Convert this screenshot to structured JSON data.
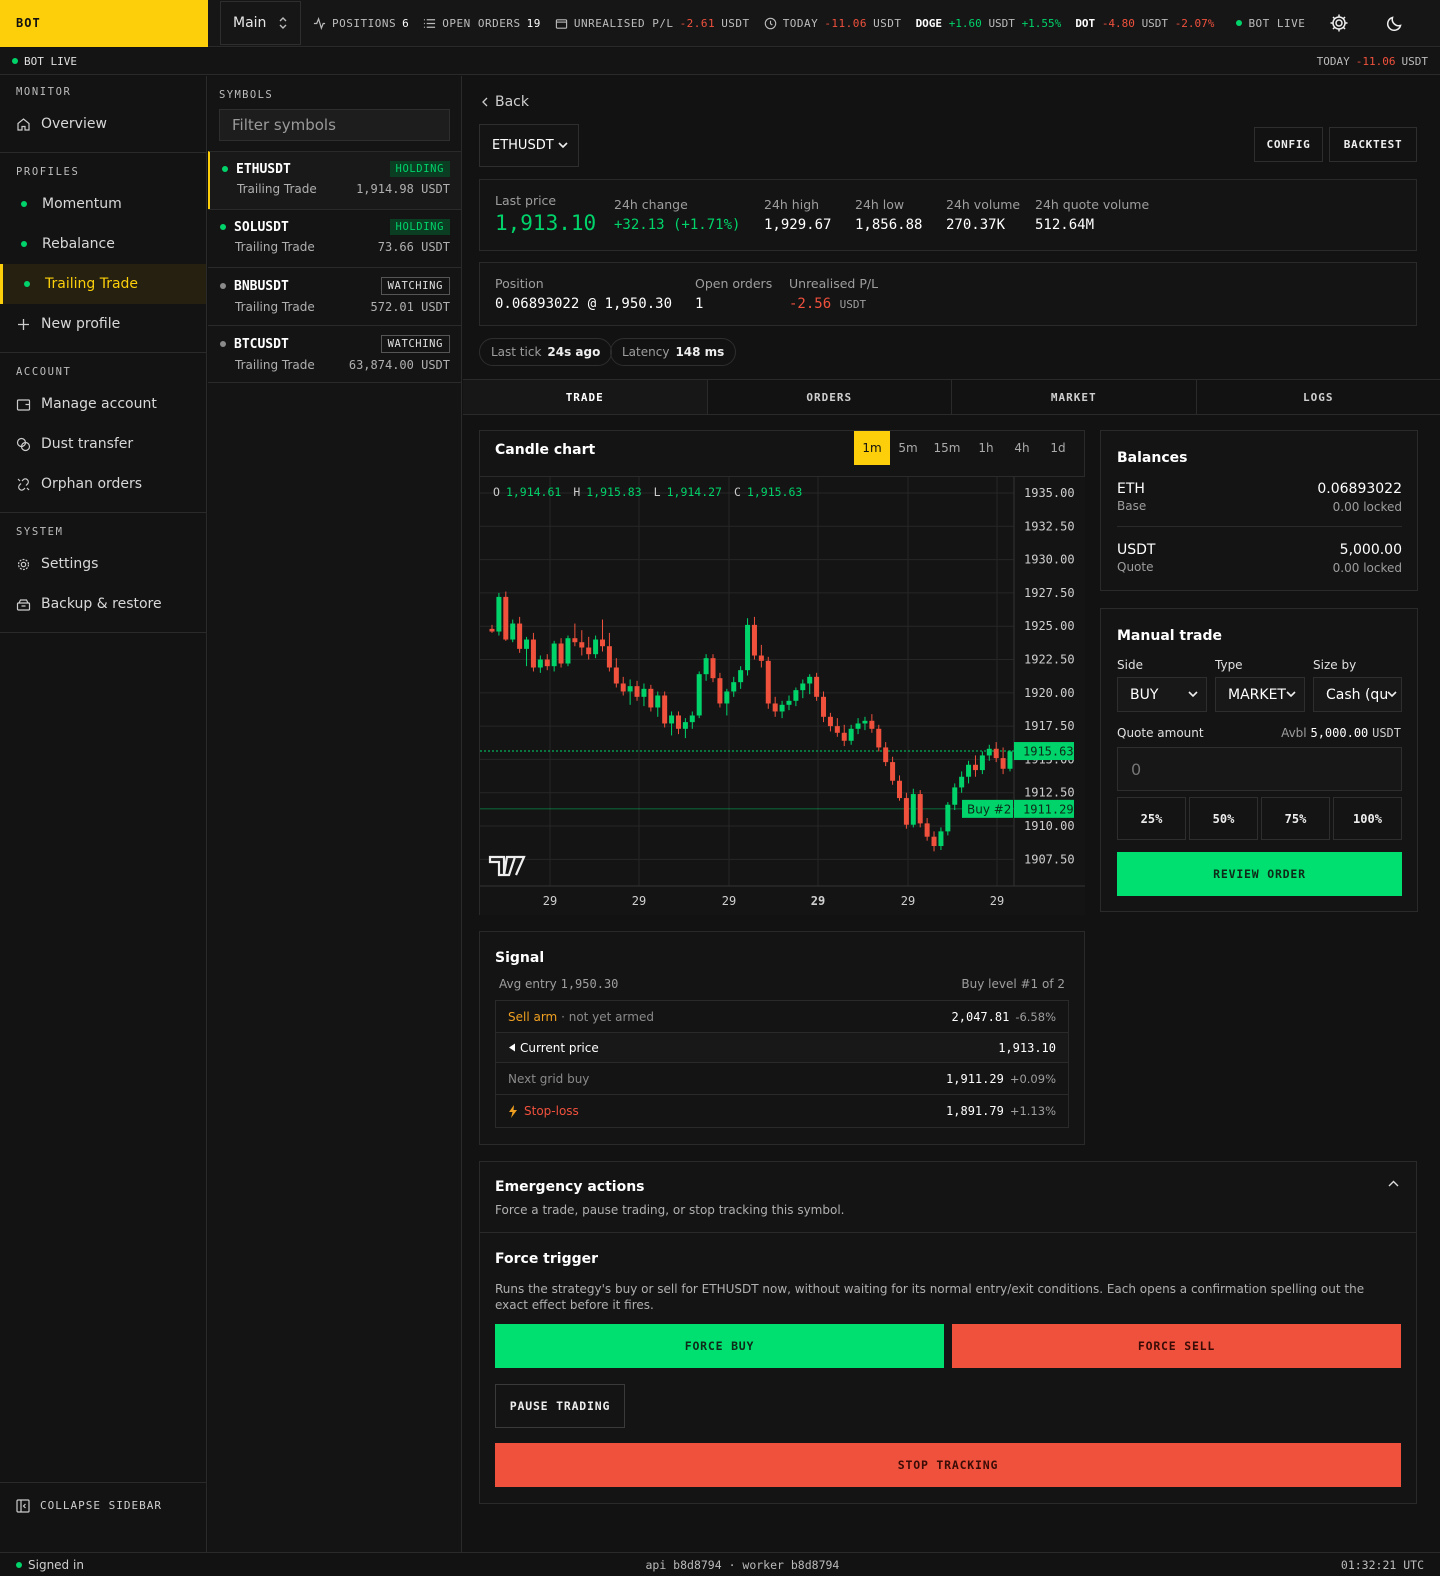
{
  "topbar": {
    "logo": "BOT",
    "profile": "Main",
    "positions_label": "POSITIONS",
    "positions_value": "6",
    "open_orders_label": "OPEN ORDERS",
    "open_orders_value": "19",
    "unrealised_label": "UNREALISED P/L",
    "unrealised_value": "-2.61",
    "unrealised_unit": "USDT",
    "today_label": "TODAY",
    "today_value": "-11.06",
    "today_unit": "USDT",
    "tickers": [
      {
        "symbol": "DOGE",
        "change": "+1.60",
        "unit": "USDT",
        "pct": "+1.55%",
        "color": "#00d36a"
      },
      {
        "symbol": "DOT",
        "change": "-4.80",
        "unit": "USDT",
        "pct": "-2.07%",
        "color": "#f0513d"
      }
    ],
    "bot_live": "BOT LIVE"
  },
  "statusbar": {
    "bot_live": "BOT LIVE",
    "today_label": "TODAY",
    "today_value": "-11.06",
    "today_unit": "USDT"
  },
  "sidebar": {
    "monitor_head": "MONITOR",
    "overview": "Overview",
    "profiles_head": "PROFILES",
    "profiles": [
      "Momentum",
      "Rebalance",
      "Trailing Trade"
    ],
    "new_profile": "New profile",
    "account_head": "ACCOUNT",
    "manage_account": "Manage account",
    "dust_transfer": "Dust transfer",
    "orphan_orders": "Orphan orders",
    "system_head": "SYSTEM",
    "settings": "Settings",
    "backup": "Backup & restore",
    "collapse": "COLLAPSE SIDEBAR"
  },
  "symbols": {
    "head": "SYMBOLS",
    "filter_placeholder": "Filter symbols",
    "items": [
      {
        "name": "ETHUSDT",
        "status": "HOLDING",
        "profile": "Trailing Trade",
        "price": "1,914.98 USDT"
      },
      {
        "name": "SOLUSDT",
        "status": "HOLDING",
        "profile": "Trailing Trade",
        "price": "73.66 USDT"
      },
      {
        "name": "BNBUSDT",
        "status": "WATCHING",
        "profile": "Trailing Trade",
        "price": "572.01 USDT"
      },
      {
        "name": "BTCUSDT",
        "status": "WATCHING",
        "profile": "Trailing Trade",
        "price": "63,874.00 USDT"
      }
    ]
  },
  "main": {
    "back": "Back",
    "symbol": "ETHUSDT",
    "config": "CONFIG",
    "backtest": "BACKTEST",
    "last_price_label": "Last price",
    "last_price": "1,913.10",
    "change_label": "24h change",
    "change": "+32.13 (+1.71%)",
    "high_label": "24h high",
    "high": "1,929.67",
    "low_label": "24h low",
    "low": "1,856.88",
    "volume_label": "24h volume",
    "volume": "270.37K",
    "quote_volume_label": "24h quote volume",
    "quote_volume": "512.64M",
    "position_label": "Position",
    "position": "0.06893022 @ 1,950.30",
    "open_orders_label": "Open orders",
    "open_orders": "1",
    "upl_label": "Unrealised P/L",
    "upl": "-2.56",
    "upl_unit": "USDT",
    "last_tick_label": "Last tick",
    "last_tick": "24s ago",
    "latency_label": "Latency",
    "latency": "148 ms",
    "tabs": [
      "TRADE",
      "ORDERS",
      "MARKET",
      "LOGS"
    ]
  },
  "chart": {
    "title": "Candle chart",
    "timeframes": [
      "1m",
      "5m",
      "15m",
      "1h",
      "4h",
      "1d"
    ],
    "ohlc": {
      "o_label": "O",
      "o": "1,914.61",
      "h_label": "H",
      "h": "1,915.83",
      "l_label": "L",
      "l": "1,914.27",
      "c_label": "C",
      "c": "1,915.63"
    }
  },
  "chart_data": {
    "type": "candlestick",
    "y_ticks": [
      "1935.00",
      "1932.50",
      "1930.00",
      "1927.50",
      "1925.00",
      "1922.50",
      "1920.00",
      "1917.50",
      "1915.00",
      "1912.50",
      "1910.00",
      "1907.50"
    ],
    "x_ticks": [
      "29",
      "29",
      "29",
      "29",
      "29",
      "29"
    ],
    "ylim": [
      1905.5,
      1936.2
    ],
    "up_color": "#00d36a",
    "down_color": "#f0513d",
    "price_tag": "1915.63",
    "buy_tag_label": "Buy #2",
    "buy_tag": "1911.29",
    "price_line": 1915.63,
    "buy_line": 1911.29,
    "candles": [
      [
        1924.8,
        1925.1,
        1924.5,
        1924.6
      ],
      [
        1924.6,
        1927.5,
        1924.3,
        1927.2
      ],
      [
        1927.2,
        1927.6,
        1923.9,
        1924.0
      ],
      [
        1924.0,
        1925.5,
        1923.8,
        1925.2
      ],
      [
        1925.2,
        1925.7,
        1923.0,
        1923.3
      ],
      [
        1923.3,
        1924.2,
        1922.0,
        1924.0
      ],
      [
        1924.0,
        1924.5,
        1921.6,
        1921.9
      ],
      [
        1921.9,
        1922.8,
        1921.5,
        1922.5
      ],
      [
        1922.5,
        1922.9,
        1921.7,
        1922.0
      ],
      [
        1922.0,
        1923.9,
        1921.6,
        1923.7
      ],
      [
        1923.7,
        1924.1,
        1921.9,
        1922.2
      ],
      [
        1922.2,
        1924.3,
        1922.0,
        1924.1
      ],
      [
        1924.1,
        1925.2,
        1923.5,
        1923.8
      ],
      [
        1923.8,
        1924.7,
        1922.8,
        1923.4
      ],
      [
        1923.4,
        1924.2,
        1922.5,
        1922.9
      ],
      [
        1922.9,
        1924.3,
        1922.6,
        1924.0
      ],
      [
        1924.0,
        1925.5,
        1923.1,
        1923.5
      ],
      [
        1923.5,
        1924.5,
        1921.6,
        1921.9
      ],
      [
        1921.9,
        1922.6,
        1920.4,
        1920.7
      ],
      [
        1920.7,
        1921.2,
        1919.8,
        1920.1
      ],
      [
        1920.1,
        1921.0,
        1919.1,
        1920.5
      ],
      [
        1920.5,
        1920.9,
        1919.4,
        1919.7
      ],
      [
        1919.7,
        1920.7,
        1919.0,
        1920.3
      ],
      [
        1920.3,
        1920.6,
        1918.6,
        1918.9
      ],
      [
        1918.9,
        1920.1,
        1918.2,
        1919.8
      ],
      [
        1919.8,
        1920.1,
        1917.4,
        1917.7
      ],
      [
        1917.7,
        1918.6,
        1916.8,
        1918.3
      ],
      [
        1918.3,
        1918.6,
        1916.9,
        1917.3
      ],
      [
        1917.3,
        1918.1,
        1916.6,
        1917.8
      ],
      [
        1917.8,
        1918.6,
        1917.3,
        1918.3
      ],
      [
        1918.3,
        1921.6,
        1918.1,
        1921.4
      ],
      [
        1921.4,
        1922.9,
        1920.9,
        1922.6
      ],
      [
        1922.6,
        1922.9,
        1920.8,
        1921.1
      ],
      [
        1921.1,
        1921.5,
        1918.9,
        1919.2
      ],
      [
        1919.2,
        1920.3,
        1918.3,
        1920.1
      ],
      [
        1920.1,
        1921.2,
        1919.7,
        1920.8
      ],
      [
        1920.8,
        1922.0,
        1920.3,
        1921.7
      ],
      [
        1921.7,
        1925.6,
        1921.3,
        1925.1
      ],
      [
        1925.1,
        1925.7,
        1922.5,
        1922.8
      ],
      [
        1922.8,
        1923.6,
        1921.9,
        1922.4
      ],
      [
        1922.4,
        1922.7,
        1918.8,
        1919.2
      ],
      [
        1919.2,
        1919.7,
        1918.2,
        1918.6
      ],
      [
        1918.6,
        1919.4,
        1918.1,
        1919.1
      ],
      [
        1919.1,
        1919.8,
        1918.7,
        1919.4
      ],
      [
        1919.4,
        1920.4,
        1919.0,
        1920.2
      ],
      [
        1920.2,
        1921.0,
        1919.6,
        1920.7
      ],
      [
        1920.7,
        1921.4,
        1919.9,
        1921.2
      ],
      [
        1921.2,
        1921.5,
        1919.4,
        1919.7
      ],
      [
        1919.7,
        1920.1,
        1917.8,
        1918.2
      ],
      [
        1918.2,
        1918.5,
        1917.1,
        1917.5
      ],
      [
        1917.5,
        1918.1,
        1916.7,
        1917.0
      ],
      [
        1917.0,
        1917.6,
        1916.0,
        1916.4
      ],
      [
        1916.4,
        1917.6,
        1916.1,
        1917.3
      ],
      [
        1917.3,
        1918.1,
        1916.9,
        1917.7
      ],
      [
        1917.7,
        1918.2,
        1917.2,
        1917.9
      ],
      [
        1917.9,
        1918.4,
        1917.0,
        1917.3
      ],
      [
        1917.3,
        1917.6,
        1915.6,
        1915.9
      ],
      [
        1915.9,
        1916.3,
        1914.5,
        1914.8
      ],
      [
        1914.8,
        1915.2,
        1913.1,
        1913.4
      ],
      [
        1913.4,
        1913.8,
        1911.9,
        1912.1
      ],
      [
        1912.1,
        1912.5,
        1909.8,
        1910.1
      ],
      [
        1910.1,
        1912.8,
        1909.9,
        1912.4
      ],
      [
        1912.4,
        1912.7,
        1909.9,
        1910.2
      ],
      [
        1910.2,
        1910.6,
        1908.9,
        1909.2
      ],
      [
        1909.2,
        1909.6,
        1908.1,
        1908.5
      ],
      [
        1908.5,
        1909.9,
        1908.2,
        1909.6
      ],
      [
        1909.6,
        1911.8,
        1909.3,
        1911.6
      ],
      [
        1911.6,
        1913.2,
        1911.2,
        1912.9
      ],
      [
        1912.9,
        1914.1,
        1912.5,
        1913.7
      ],
      [
        1913.7,
        1914.9,
        1913.2,
        1914.6
      ],
      [
        1914.6,
        1915.3,
        1913.7,
        1914.2
      ],
      [
        1914.2,
        1915.6,
        1913.9,
        1915.3
      ],
      [
        1915.3,
        1916.1,
        1914.9,
        1915.8
      ],
      [
        1915.8,
        1916.3,
        1914.8,
        1915.1
      ],
      [
        1915.1,
        1915.9,
        1913.9,
        1914.3
      ],
      [
        1914.3,
        1915.7,
        1914.1,
        1915.6
      ]
    ]
  },
  "signal": {
    "title": "Signal",
    "avg_entry_label": "Avg entry",
    "avg_entry": "1,950.30",
    "buy_level": "Buy level #1 of 2",
    "sell_arm_label": "Sell arm",
    "sell_arm_note": "· not yet armed",
    "sell_arm_value": "2,047.81",
    "sell_arm_pct": "-6.58%",
    "current_label": "Current price",
    "current_value": "1,913.10",
    "next_buy_label": "Next grid buy",
    "next_buy_value": "1,911.29",
    "next_buy_pct": "+0.09%",
    "stop_loss_label": "Stop-loss",
    "stop_loss_value": "1,891.79",
    "stop_loss_pct": "+1.13%"
  },
  "balances": {
    "title": "Balances",
    "items": [
      {
        "asset": "ETH",
        "type": "Base",
        "amount": "0.06893022",
        "locked": "0.00 locked"
      },
      {
        "asset": "USDT",
        "type": "Quote",
        "amount": "5,000.00",
        "locked": "0.00 locked"
      }
    ]
  },
  "manual": {
    "title": "Manual trade",
    "side_label": "Side",
    "side": "BUY",
    "type_label": "Type",
    "type": "MARKET",
    "size_label": "Size by",
    "size": "Cash (quote)",
    "quote_label": "Quote amount",
    "avbl_label": "Avbl",
    "avbl_value": "5,000.00",
    "avbl_unit": "USDT",
    "amount_placeholder": "0",
    "pcts": [
      "25%",
      "50%",
      "75%",
      "100%"
    ],
    "review": "REVIEW ORDER"
  },
  "emergency": {
    "title": "Emergency actions",
    "subtitle": "Force a trade, pause trading, or stop tracking this symbol.",
    "force_title": "Force trigger",
    "force_desc": "Runs the strategy's buy or sell for ETHUSDT now, without waiting for its normal entry/exit conditions. Each opens a confirmation spelling out the exact effect before it fires.",
    "force_buy": "FORCE BUY",
    "force_sell": "FORCE SELL",
    "pause": "PAUSE TRADING",
    "stop": "STOP TRACKING"
  },
  "footer": {
    "signed_in": "Signed in",
    "build": "api b8d8794 · worker b8d8794",
    "time": "01:32:21 UTC"
  }
}
